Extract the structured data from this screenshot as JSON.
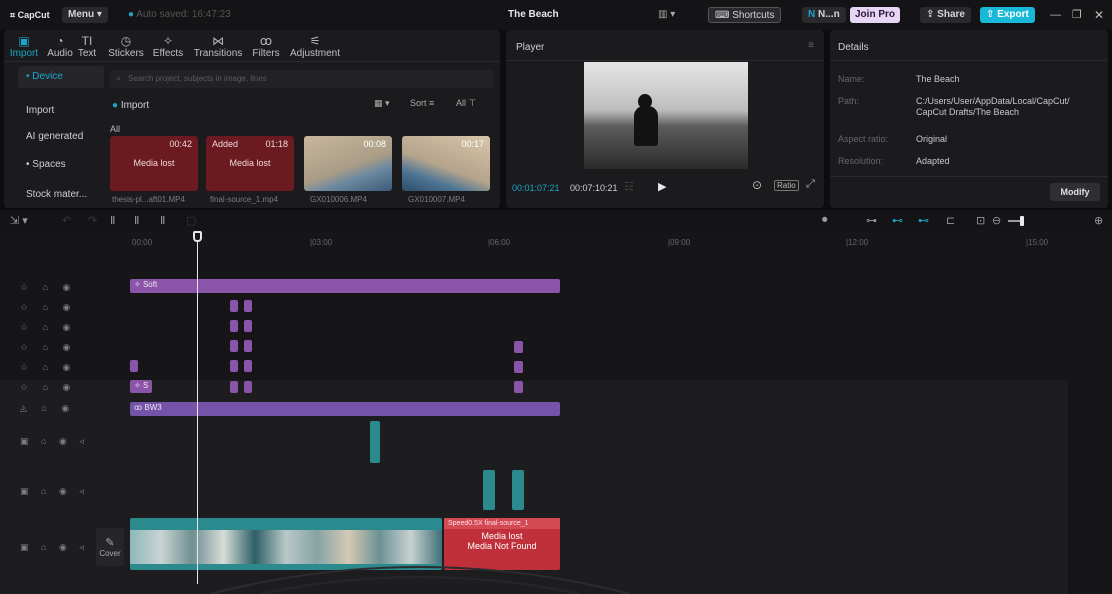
{
  "topbar": {
    "logo": "CapCut",
    "menu": "Menu",
    "autosave": "Auto saved: 16:47:23",
    "project_title": "The Beach",
    "shortcuts": "Shortcuts",
    "user": "N...n",
    "join_pro": "Join Pro",
    "share": "Share",
    "export": "Export"
  },
  "tools": [
    "Import",
    "Audio",
    "Text",
    "Stickers",
    "Effects",
    "Transitions",
    "Filters",
    "Adjustment"
  ],
  "sidebar": {
    "items": [
      "• Device",
      "Import",
      "AI generated",
      "• Spaces",
      "Stock mater..."
    ]
  },
  "media": {
    "search_placeholder": "Search project, subjects in image, lines",
    "import_label": "Import",
    "sort_label": "Sort",
    "all_label": "All",
    "all_header": "All",
    "items": [
      {
        "duration": "00:42",
        "status": "Media lost",
        "added": "",
        "name": "thesis-pl...aft01.MP4"
      },
      {
        "duration": "01:18",
        "status": "Media lost",
        "added": "Added",
        "name": "final-source_1.mp4"
      },
      {
        "duration": "00:08",
        "status": "",
        "added": "",
        "name": "GX010006.MP4"
      },
      {
        "duration": "00:17",
        "status": "",
        "added": "",
        "name": "GX010007.MP4"
      }
    ]
  },
  "player": {
    "title": "Player",
    "current_time": "00:01:07:21",
    "total_time": "00:07:10:21",
    "ratio_label": "Ratio"
  },
  "details": {
    "title": "Details",
    "rows": [
      {
        "label": "Name:",
        "value": "The Beach"
      },
      {
        "label": "Path:",
        "value": "C:/Users/User/AppData/Local/CapCut/ CapCut Drafts/The Beach"
      },
      {
        "label": "Aspect ratio:",
        "value": "Original"
      },
      {
        "label": "Resolution:",
        "value": "Adapted"
      }
    ],
    "modify": "Modify"
  },
  "timeline": {
    "ruler": [
      "00:00",
      "|03:00",
      "|06:00",
      "|09:00",
      "|12:00",
      "|15:00"
    ],
    "clip_soft": "Soft",
    "clip_bw3": "BW3",
    "clip_s": "S",
    "cover_label": "Cover",
    "lost_title": "Speed0.5X  final-source_1",
    "lost_text_1": "Media lost",
    "lost_text_2": "Media Not Found"
  },
  "colors": {
    "accent": "#1aa6c8",
    "purple_clip": "#8a55a8",
    "lost_red": "#c0303a",
    "teal_clip": "#2a8a8e"
  }
}
